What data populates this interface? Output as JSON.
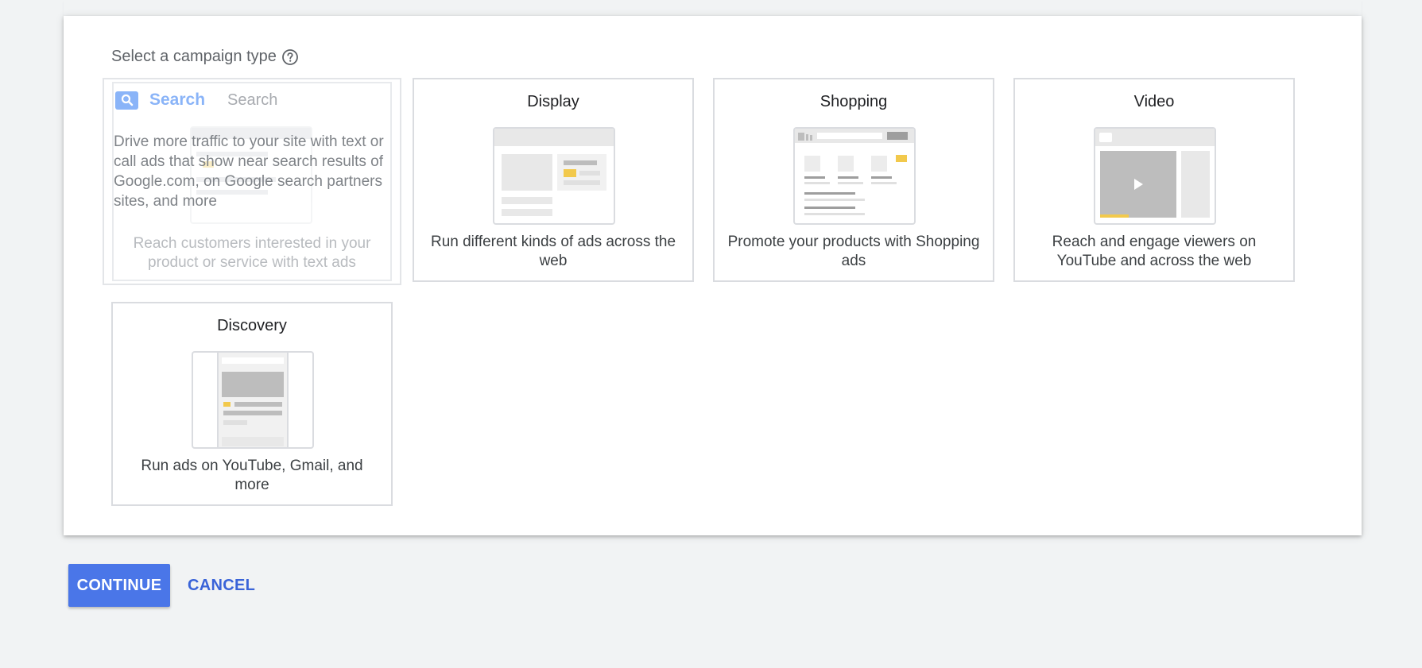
{
  "heading": "Select a campaign type",
  "search_card": {
    "brand": "Search",
    "title": "Search",
    "description": "Drive more traffic to your site with text or call ads that show near search results of Google.com, on Google search partners sites, and more",
    "subtitle": "Reach customers interested in your product or service with text ads"
  },
  "cards": {
    "display": {
      "title": "Display",
      "description": "Run different kinds of ads across the web"
    },
    "shopping": {
      "title": "Shopping",
      "description": "Promote your products with Shopping ads"
    },
    "video": {
      "title": "Video",
      "description": "Reach and engage viewers on YouTube and across the web"
    },
    "discovery": {
      "title": "Discovery",
      "description": "Run ads on YouTube, Gmail, and more"
    }
  },
  "actions": {
    "continue": "CONTINUE",
    "cancel": "CANCEL"
  },
  "colors": {
    "primary": "#4a76e8",
    "accent_yellow": "#f2c94c",
    "search_blue": "#8ab4f8"
  }
}
